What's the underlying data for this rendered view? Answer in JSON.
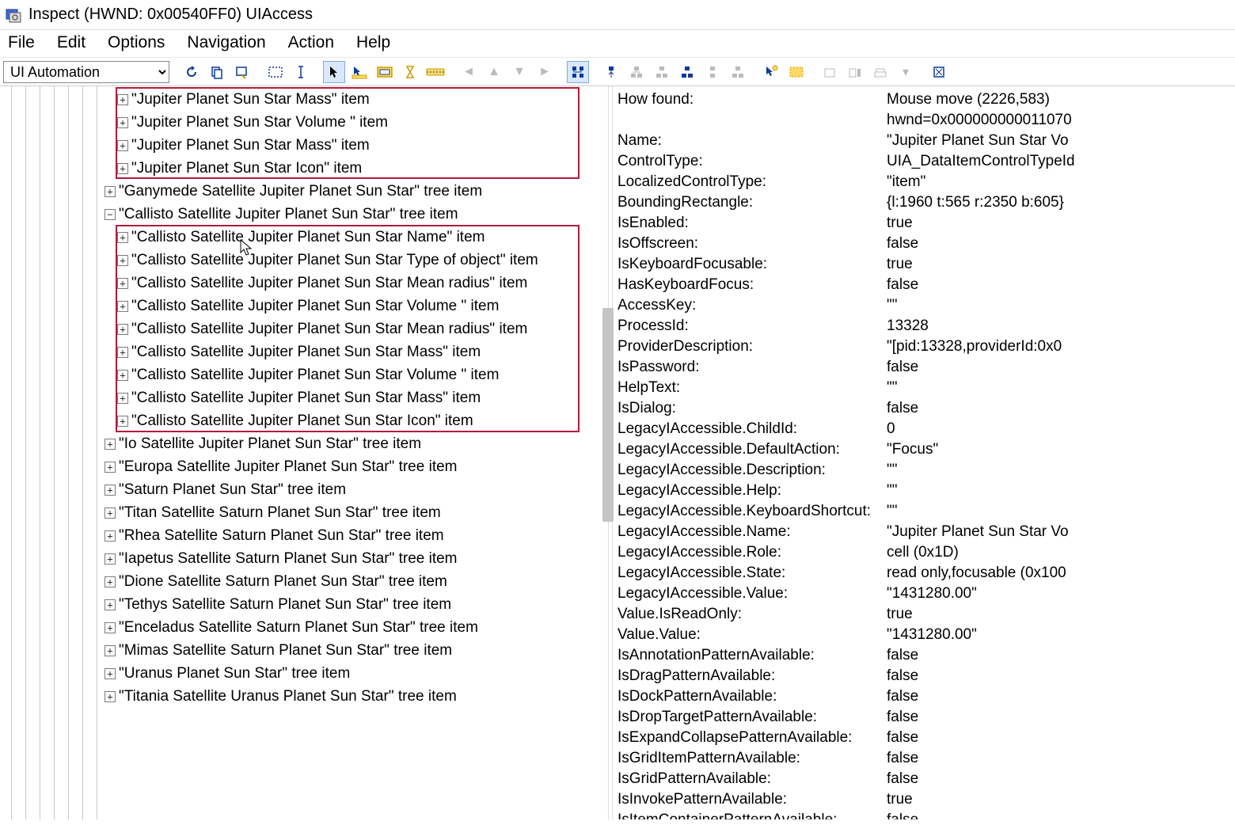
{
  "window": {
    "title": "Inspect  (HWND: 0x00540FF0) UIAccess"
  },
  "menu": {
    "file": "File",
    "edit": "Edit",
    "options": "Options",
    "navigation": "Navigation",
    "action": "Action",
    "help": "Help"
  },
  "toolbar": {
    "mode": "UI Automation"
  },
  "tree": {
    "jupiter_group": [
      "\"Jupiter Planet Sun Star Mass\" item",
      "\"Jupiter Planet Sun Star Volume \" item",
      "\"Jupiter Planet Sun Star Mass\" item",
      "\"Jupiter Planet Sun Star Icon\" item"
    ],
    "ganymede": "\"Ganymede Satellite Jupiter Planet Sun Star\" tree item",
    "callisto_header": "\"Callisto Satellite Jupiter Planet Sun Star\" tree item",
    "callisto_group": [
      "\"Callisto Satellite Jupiter Planet Sun Star Name\" item",
      "\"Callisto Satellite Jupiter Planet Sun Star Type of object\" item",
      "\"Callisto Satellite Jupiter Planet Sun Star Mean radius\" item",
      "\"Callisto Satellite Jupiter Planet Sun Star Volume \" item",
      "\"Callisto Satellite Jupiter Planet Sun Star Mean radius\" item",
      "\"Callisto Satellite Jupiter Planet Sun Star Mass\" item",
      "\"Callisto Satellite Jupiter Planet Sun Star Volume \" item",
      "\"Callisto Satellite Jupiter Planet Sun Star Mass\" item",
      "\"Callisto Satellite Jupiter Planet Sun Star Icon\" item"
    ],
    "rest": [
      "\"Io Satellite Jupiter Planet Sun Star\" tree item",
      "\"Europa Satellite Jupiter Planet Sun Star\" tree item",
      "\"Saturn Planet Sun Star\" tree item",
      "\"Titan Satellite Saturn Planet Sun Star\" tree item",
      "\"Rhea Satellite Saturn Planet Sun Star\" tree item",
      "\"Iapetus Satellite Saturn Planet Sun Star\" tree item",
      "\"Dione Satellite Saturn Planet Sun Star\" tree item",
      "\"Tethys Satellite Saturn Planet Sun Star\" tree item",
      "\"Enceladus Satellite Saturn Planet Sun Star\" tree item",
      "\"Mimas Satellite Saturn Planet Sun Star\" tree item",
      "\"Uranus Planet Sun Star\" tree item",
      "\"Titania Satellite Uranus Planet Sun Star\" tree item"
    ]
  },
  "props": [
    {
      "k": "How found:",
      "v": "Mouse move (2226,583)"
    },
    {
      "k": "",
      "v": "hwnd=0x000000000011070"
    },
    {
      "k": "Name:",
      "v": "\"Jupiter Planet Sun Star Vo"
    },
    {
      "k": "ControlType:",
      "v": "UIA_DataItemControlTypeId"
    },
    {
      "k": "LocalizedControlType:",
      "v": "\"item\""
    },
    {
      "k": "BoundingRectangle:",
      "v": "{l:1960 t:565 r:2350 b:605}"
    },
    {
      "k": "IsEnabled:",
      "v": "true"
    },
    {
      "k": "IsOffscreen:",
      "v": "false"
    },
    {
      "k": "IsKeyboardFocusable:",
      "v": "true"
    },
    {
      "k": "HasKeyboardFocus:",
      "v": "false"
    },
    {
      "k": "AccessKey:",
      "v": "\"\""
    },
    {
      "k": "ProcessId:",
      "v": "13328"
    },
    {
      "k": "ProviderDescription:",
      "v": "\"[pid:13328,providerId:0x0 "
    },
    {
      "k": "IsPassword:",
      "v": "false"
    },
    {
      "k": "HelpText:",
      "v": "\"\""
    },
    {
      "k": "IsDialog:",
      "v": "false"
    },
    {
      "k": "LegacyIAccessible.ChildId:",
      "v": "0"
    },
    {
      "k": "LegacyIAccessible.DefaultAction:",
      "v": "\"Focus\""
    },
    {
      "k": "LegacyIAccessible.Description:",
      "v": "\"\""
    },
    {
      "k": "LegacyIAccessible.Help:",
      "v": "\"\""
    },
    {
      "k": "LegacyIAccessible.KeyboardShortcut:",
      "v": "\"\""
    },
    {
      "k": "LegacyIAccessible.Name:",
      "v": "\"Jupiter Planet Sun Star Vo"
    },
    {
      "k": "LegacyIAccessible.Role:",
      "v": "cell (0x1D)"
    },
    {
      "k": "LegacyIAccessible.State:",
      "v": "read only,focusable (0x100"
    },
    {
      "k": "LegacyIAccessible.Value:",
      "v": "\"1431280.00\""
    },
    {
      "k": "Value.IsReadOnly:",
      "v": "true"
    },
    {
      "k": "Value.Value:",
      "v": "\"1431280.00\""
    },
    {
      "k": "IsAnnotationPatternAvailable:",
      "v": "false"
    },
    {
      "k": "IsDragPatternAvailable:",
      "v": "false"
    },
    {
      "k": "IsDockPatternAvailable:",
      "v": "false"
    },
    {
      "k": "IsDropTargetPatternAvailable:",
      "v": "false"
    },
    {
      "k": "IsExpandCollapsePatternAvailable:",
      "v": "false"
    },
    {
      "k": "IsGridItemPatternAvailable:",
      "v": "false"
    },
    {
      "k": "IsGridPatternAvailable:",
      "v": "false"
    },
    {
      "k": "IsInvokePatternAvailable:",
      "v": "true"
    },
    {
      "k": "IsItemContainerPatternAvailable:",
      "v": "false"
    }
  ]
}
